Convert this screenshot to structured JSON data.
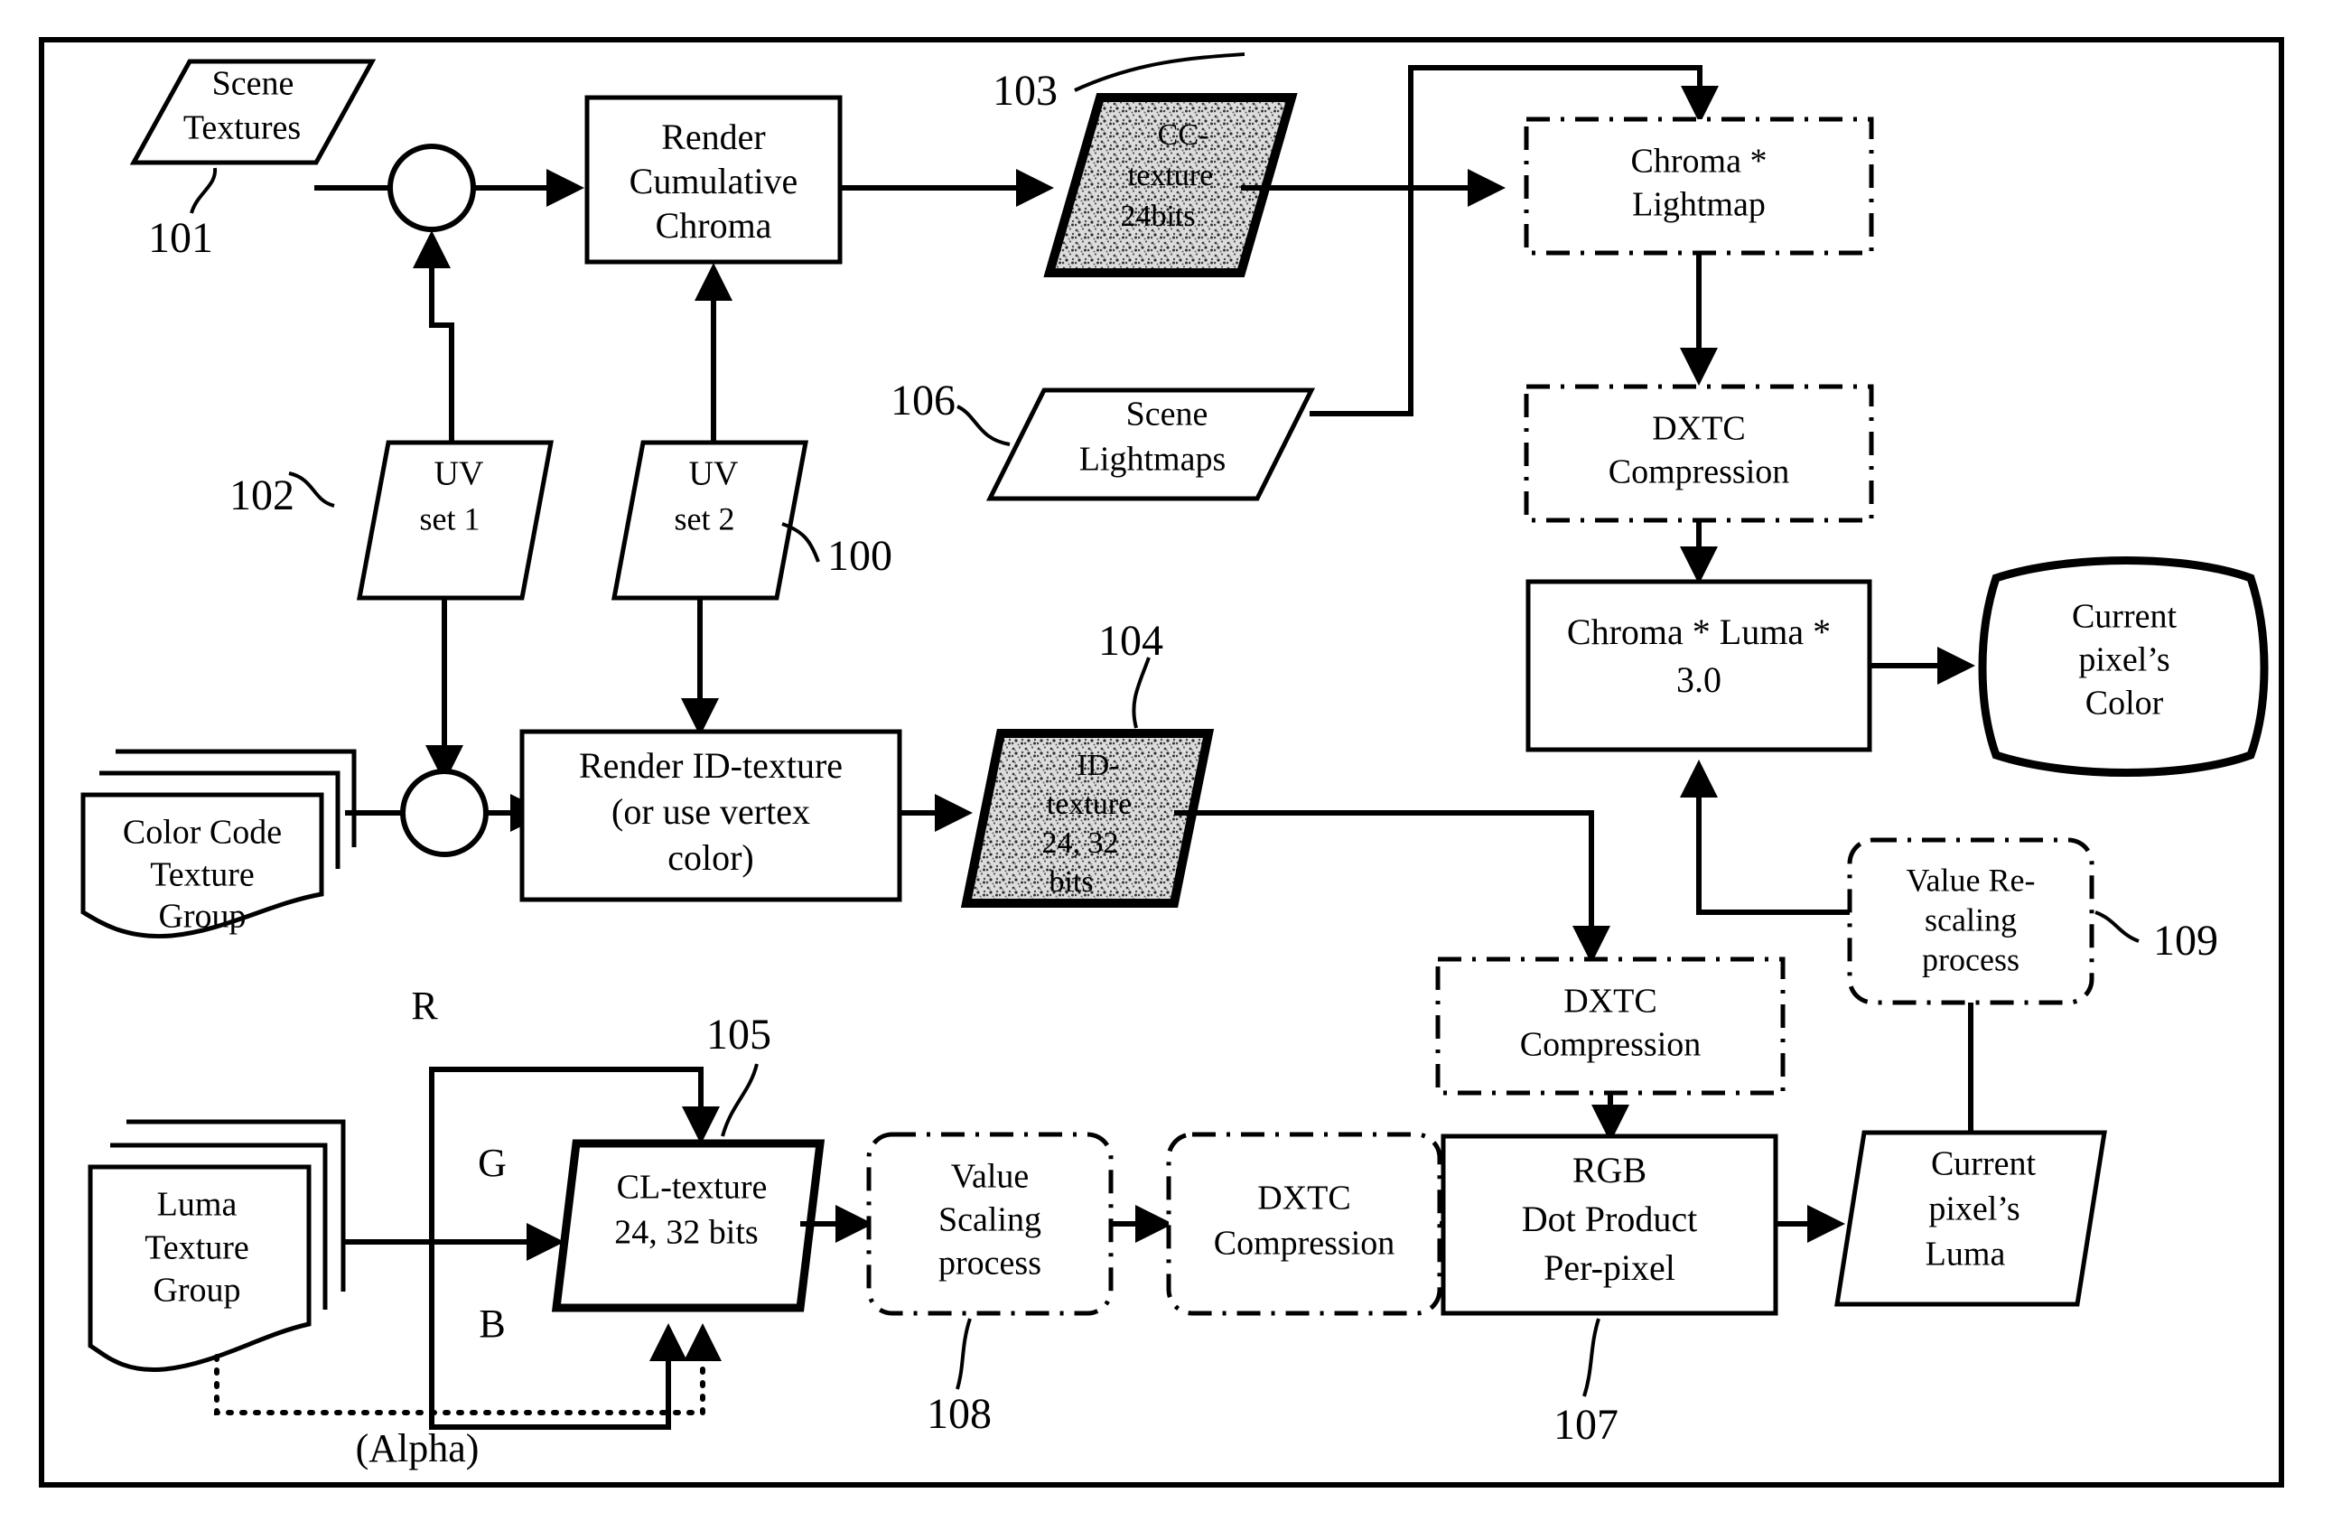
{
  "figure": {
    "title": "Texture compression and per-pixel chroma/luma rendering pipeline",
    "frame_label": ""
  },
  "nodes": {
    "scene_textures": {
      "label_line1": "Scene",
      "label_line2": "Textures",
      "ref": "101",
      "shape": "parallelogram"
    },
    "render_cumulative_chroma": {
      "label_line1": "Render",
      "label_line2": "Cumulative",
      "label_line3": "Chroma",
      "shape": "process"
    },
    "cc_texture": {
      "label_line1": "CC-",
      "label_line2": "texture",
      "label_line3": "24bits",
      "ref": "103",
      "shape": "textured-parallelogram"
    },
    "uv_set_1": {
      "label_line1": "UV",
      "label_line2": "set 1",
      "ref": "102",
      "shape": "parallelogram"
    },
    "uv_set_2": {
      "label_line1": "UV",
      "label_line2": "set 2",
      "ref": "100",
      "shape": "parallelogram"
    },
    "scene_lightmaps": {
      "label_line1": "Scene",
      "label_line2": "Lightmaps",
      "ref": "106",
      "shape": "parallelogram"
    },
    "chroma_lightmap": {
      "label_line1": "Chroma *",
      "label_line2": "Lightmap",
      "shape": "dashed-process"
    },
    "dxtc_compression_top": {
      "label_line1": "DXTC",
      "label_line2": "Compression",
      "shape": "dashed-process"
    },
    "chroma_luma_3": {
      "label_line1": "Chroma * Luma *",
      "label_line2": "3.0",
      "shape": "process"
    },
    "current_pixels_color": {
      "label_line1": "Current",
      "label_line2": "pixel’s",
      "label_line3": "Color",
      "shape": "barrel"
    },
    "color_code_texture_group": {
      "label_line1": "Color Code",
      "label_line2": "Texture",
      "label_line3": "Group",
      "shape": "document-stack"
    },
    "render_id_texture": {
      "label_line1": "Render ID-texture",
      "label_line2": "(or use vertex",
      "label_line3": "color)",
      "shape": "process"
    },
    "id_texture": {
      "label_line1": "ID-",
      "label_line2": "texture",
      "label_line3": "24, 32",
      "label_line4": "bits",
      "ref": "104",
      "shape": "textured-parallelogram"
    },
    "dxtc_compression_mid": {
      "label_line1": "DXTC",
      "label_line2": "Compression",
      "shape": "dashed-process"
    },
    "value_rescaling_process": {
      "label_line1": "Value Re-",
      "label_line2": "scaling",
      "label_line3": "process",
      "ref": "109",
      "shape": "dashed-rounded"
    },
    "luma_texture_group": {
      "label_line1": "Luma",
      "label_line2": "Texture",
      "label_line3": "Group",
      "shape": "document-stack"
    },
    "cl_texture": {
      "label_line1": "CL-texture",
      "label_line2": "24, 32 bits",
      "ref": "105",
      "shape": "parallelogram"
    },
    "value_scaling_process": {
      "label_line1": "Value",
      "label_line2": "Scaling",
      "label_line3": "process",
      "ref": "108",
      "shape": "dashed-rounded"
    },
    "dxtc_compression_bottom": {
      "label_line1": "DXTC",
      "label_line2": "Compression",
      "shape": "dashed-rounded"
    },
    "rgb_dot_product": {
      "label_line1": "RGB",
      "label_line2": "Dot Product",
      "label_line3": "Per-pixel",
      "ref": "107",
      "shape": "process"
    },
    "current_pixels_luma": {
      "label_line1": "Current",
      "label_line2": "pixel’s",
      "label_line3": "Luma",
      "shape": "parallelogram"
    }
  },
  "channel_labels": {
    "r": "R",
    "g": "G",
    "b": "B",
    "alpha": "(Alpha)"
  },
  "reference_numerals": [
    "100",
    "101",
    "102",
    "103",
    "104",
    "105",
    "106",
    "107",
    "108",
    "109"
  ],
  "colors": {
    "line": "#000000",
    "fill": "#ffffff",
    "texture_fill": "#d4d4d4"
  }
}
